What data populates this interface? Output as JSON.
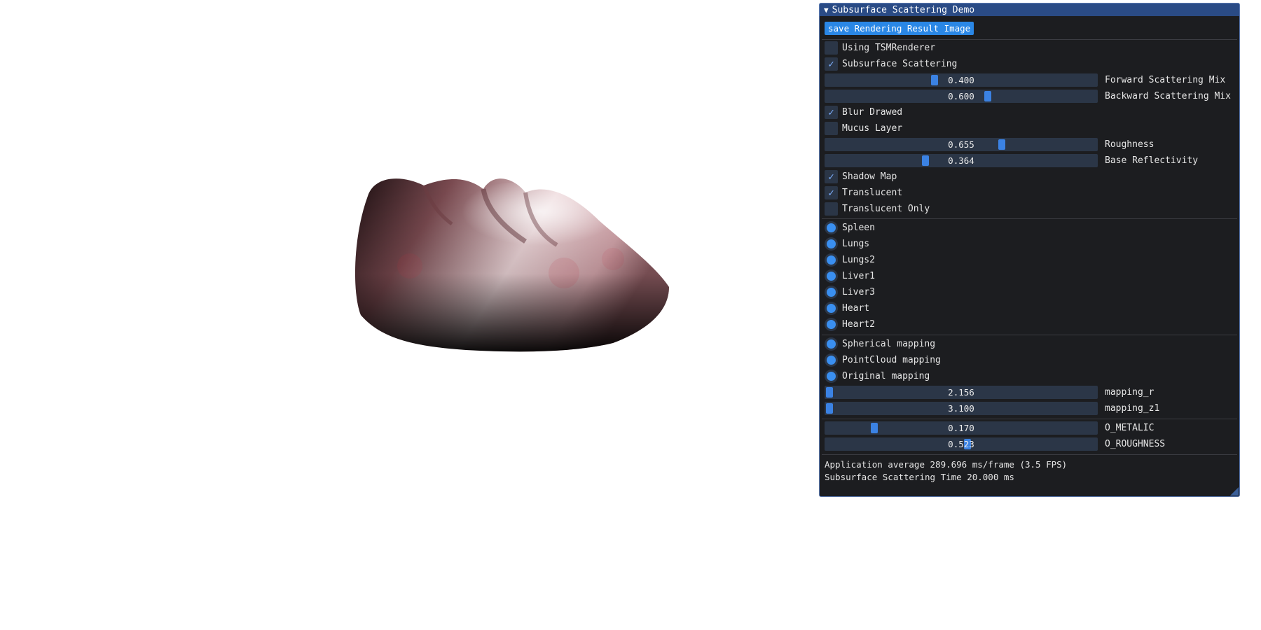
{
  "panel": {
    "title": "Subsurface Scattering Demo",
    "save_button": "save Rendering Result Image",
    "checkboxes_a": [
      {
        "label": "Using TSMRenderer",
        "checked": false
      },
      {
        "label": "Subsurface Scattering",
        "checked": true
      }
    ],
    "sliders_a": [
      {
        "label": "Forward Scattering Mix",
        "value": "0.400",
        "fraction": 0.4
      },
      {
        "label": "Backward Scattering Mix",
        "value": "0.600",
        "fraction": 0.6
      }
    ],
    "checkboxes_b": [
      {
        "label": "Blur Drawed",
        "checked": true
      },
      {
        "label": "Mucus Layer",
        "checked": false
      }
    ],
    "sliders_b": [
      {
        "label": "Roughness",
        "value": "0.655",
        "fraction": 0.655
      },
      {
        "label": "Base Reflectivity",
        "value": "0.364",
        "fraction": 0.364
      }
    ],
    "checkboxes_c": [
      {
        "label": "Shadow Map",
        "checked": true
      },
      {
        "label": "Translucent",
        "checked": true
      },
      {
        "label": "Translucent Only",
        "checked": false
      }
    ],
    "organs": [
      "Spleen",
      "Lungs",
      "Lungs2",
      "Liver1",
      "Liver3",
      "Heart",
      "Heart2"
    ],
    "mappings": [
      "Spherical mapping",
      "PointCloud mapping",
      "Original mapping"
    ],
    "sliders_c": [
      {
        "label": "mapping_r",
        "value": "2.156",
        "fraction": 0.0
      },
      {
        "label": "mapping_z1",
        "value": "3.100",
        "fraction": 0.0
      }
    ],
    "sliders_d": [
      {
        "label": "O_METALIC",
        "value": "0.170",
        "fraction": 0.17
      },
      {
        "label": "O_ROUGHNESS",
        "value": "0.523",
        "fraction": 0.523
      }
    ],
    "stats": [
      "Application average 289.696 ms/frame (3.5 FPS)",
      "Subsurface Scattering Time 20.000 ms"
    ]
  },
  "colors": {
    "title_bar": "#2a4b85",
    "button": "#2a87e6",
    "frame_bg": "#2b3647",
    "accent": "#3b82e3",
    "window_bg": "#1c1d20"
  }
}
